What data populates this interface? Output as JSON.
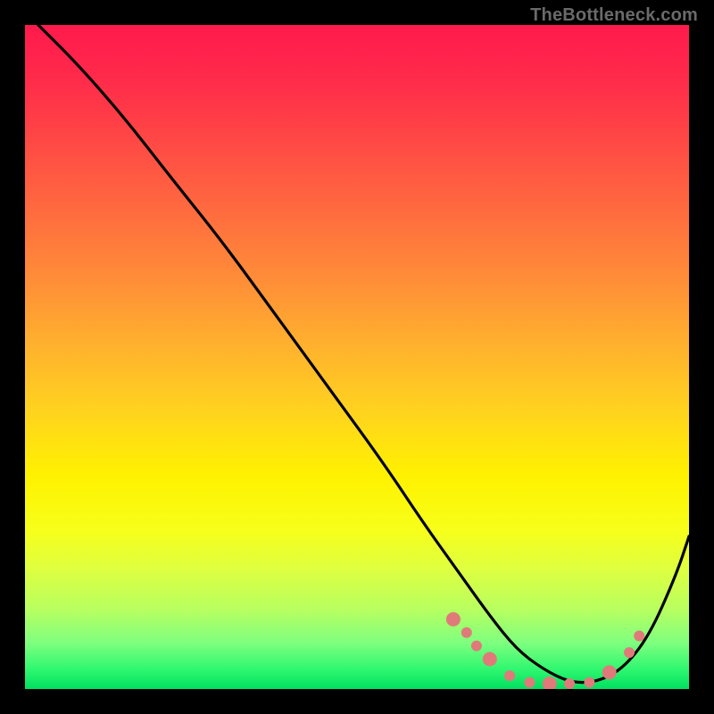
{
  "attribution": "TheBottleneck.com",
  "colors": {
    "gradient_top": "#ff1a4d",
    "gradient_bottom": "#00e060",
    "curve": "#000000",
    "dots": "#e07a7a",
    "background": "#000000",
    "attribution_text": "#6a6a6a"
  },
  "chart_data": {
    "type": "line",
    "title": "",
    "xlabel": "",
    "ylabel": "",
    "xlim": [
      0,
      100
    ],
    "ylim": [
      0,
      100
    ],
    "series": [
      {
        "name": "curve",
        "x": [
          2,
          8,
          15,
          22,
          30,
          38,
          46,
          54,
          60,
          65,
          70,
          74,
          78,
          82,
          86,
          90,
          94,
          98,
          100
        ],
        "y": [
          100,
          94,
          86,
          77,
          67,
          56,
          45,
          34,
          25,
          18,
          11,
          6,
          3,
          1,
          1,
          3,
          8,
          17,
          23
        ]
      },
      {
        "name": "dots",
        "x": [
          64.5,
          66.5,
          68,
          70,
          73,
          76,
          79,
          82,
          85,
          88,
          91,
          92.5
        ],
        "y": [
          10.5,
          8.5,
          6.5,
          4.5,
          2,
          1,
          0.8,
          0.8,
          1,
          2.5,
          5.5,
          8
        ]
      }
    ]
  }
}
